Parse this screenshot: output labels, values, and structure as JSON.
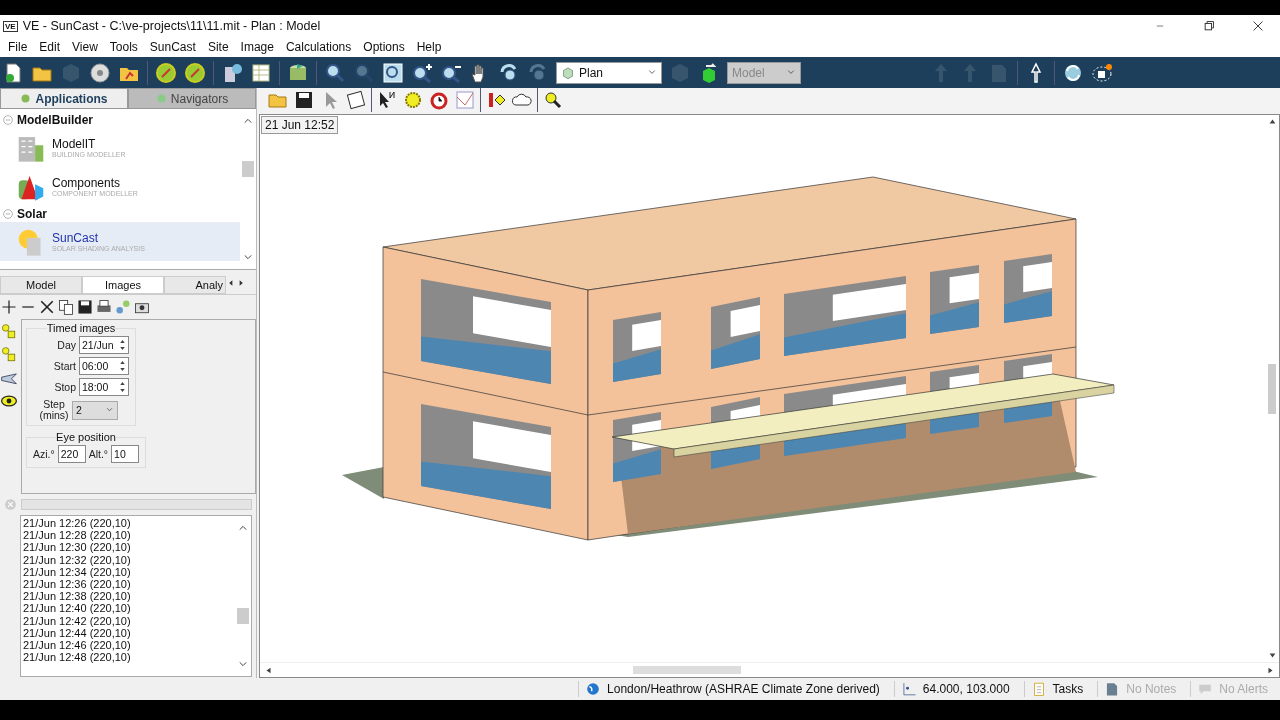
{
  "window": {
    "badge": "VE",
    "title": "VE - SunCast - C:\\ve-projects\\11\\11.mit - Plan : Model"
  },
  "menu": [
    "File",
    "Edit",
    "View",
    "Tools",
    "SunCast",
    "Site",
    "Image",
    "Calculations",
    "Options",
    "Help"
  ],
  "toolbar": {
    "view_select": "Plan",
    "mode_select": {
      "value": "Model",
      "disabled": true
    }
  },
  "panel_tabs": [
    {
      "label": "Applications",
      "selected": true
    },
    {
      "label": "Navigators",
      "selected": false
    }
  ],
  "app_groups": [
    {
      "title": "ModelBuilder",
      "expanded": true,
      "items": [
        {
          "name": "ModelIT",
          "subtitle": "BUILDING MODELLER",
          "selected": false
        },
        {
          "name": "Components",
          "subtitle": "COMPONENT MODELLER",
          "selected": false
        }
      ]
    },
    {
      "title": "Solar",
      "expanded": true,
      "items": [
        {
          "name": "SunCast",
          "subtitle": "SOLAR SHADING ANALYSIS",
          "selected": true
        }
      ]
    }
  ],
  "sub_tabs": [
    {
      "label": "Model",
      "selected": false
    },
    {
      "label": "Images",
      "selected": true
    },
    {
      "label": "Analy",
      "selected": false
    }
  ],
  "timed_images": {
    "title": "Timed images",
    "day_label": "Day",
    "day": "21/Jun",
    "start_label": "Start",
    "start": "06:00",
    "stop_label": "Stop",
    "stop": "18:00",
    "step_label": "Step (mins)",
    "step": "2"
  },
  "eye_position": {
    "title": "Eye position",
    "azi_label": "Azi.°",
    "azi": "220",
    "alt_label": "Alt.°",
    "alt": "10"
  },
  "progress": {
    "level": 0
  },
  "image_list": [
    "21/Jun 12:26 (220,10)",
    "21/Jun 12:28 (220,10)",
    "21/Jun 12:30 (220,10)",
    "21/Jun 12:32 (220,10)",
    "21/Jun 12:34 (220,10)",
    "21/Jun 12:36 (220,10)",
    "21/Jun 12:38 (220,10)",
    "21/Jun 12:40 (220,10)",
    "21/Jun 12:42 (220,10)",
    "21/Jun 12:44 (220,10)",
    "21/Jun 12:46 (220,10)",
    "21/Jun 12:48 (220,10)"
  ],
  "viewport": {
    "timestamp": "21 Jun 12:52"
  },
  "status_bar": {
    "location": "London/Heathrow (ASHRAE Climate Zone derived)",
    "coordinates": "64.000, 103.000",
    "tasks": "Tasks",
    "notes": "No Notes",
    "alerts": "No Alerts"
  }
}
